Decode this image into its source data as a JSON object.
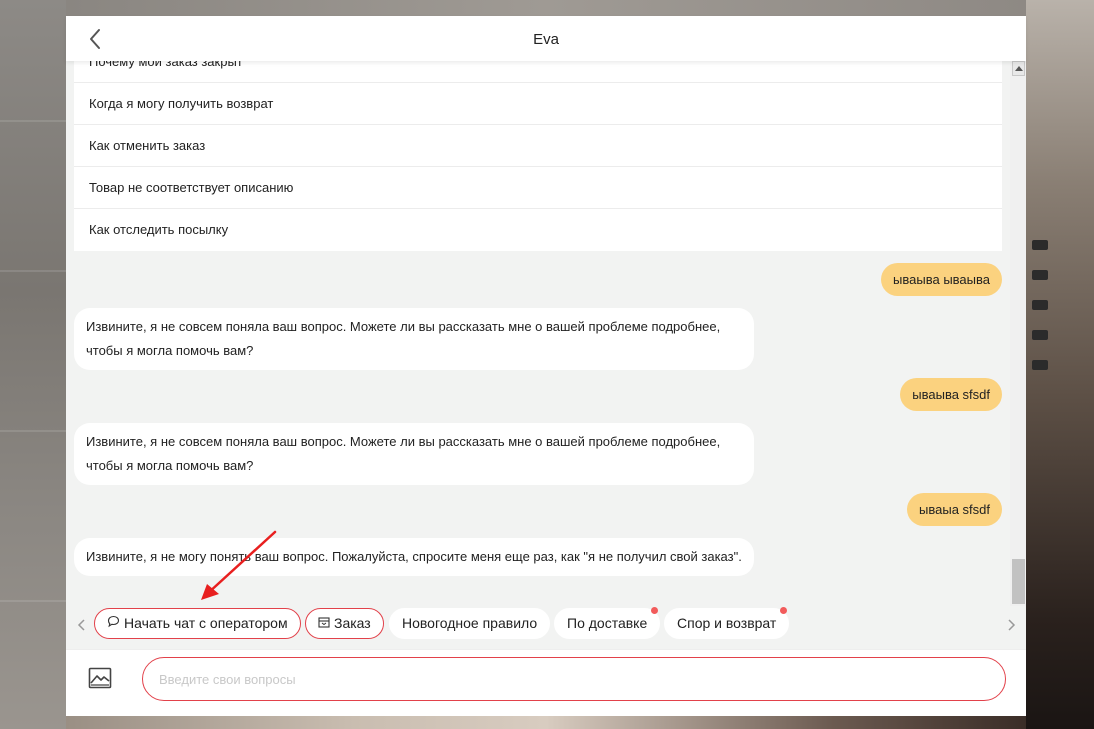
{
  "window": {
    "title": "Eva",
    "back_icon": "chevron-left-icon"
  },
  "faq": {
    "items": [
      "Почему мой заказ закрыт",
      "Когда я могу получить возврат",
      "Как отменить заказ",
      "Товар не соответствует описанию",
      "Как отследить посылку"
    ]
  },
  "messages": [
    {
      "from": "user",
      "text": "ываыва ываыва"
    },
    {
      "from": "bot",
      "text": "Извините, я не совсем поняла ваш вопрос. Можете ли вы рассказать мне о вашей проблеме подробнее, чтобы я могла помочь вам?"
    },
    {
      "from": "user",
      "text": "ываыва sfsdf"
    },
    {
      "from": "bot",
      "text": "Извините, я не совсем поняла ваш вопрос. Можете ли вы рассказать мне о вашей проблеме подробнее, чтобы я могла помочь вам?"
    },
    {
      "from": "user",
      "text": "ываыа sfsdf"
    },
    {
      "from": "bot",
      "text": "Извините, я не могу понять ваш вопрос. Пожалуйста, спросите меня еще раз, как \"я не получил свой заказ\"."
    }
  ],
  "quick_actions": [
    {
      "label": "Начать чат с оператором",
      "icon": "chat-bubble-icon"
    },
    {
      "label": "Заказ",
      "icon": "package-icon"
    },
    {
      "label": "Новогодное правило"
    },
    {
      "label": "По доставке"
    },
    {
      "label": "Спор и возврат"
    }
  ],
  "input": {
    "placeholder": "Введите свои вопросы",
    "value": "",
    "image_icon": "image-upload-icon"
  },
  "colors": {
    "accent": "#e2414a",
    "user_bubble": "#fbd27f",
    "chat_bg": "#f2f3f2",
    "notification_dot": "#f25b5b",
    "annotation_arrow": "#e81f1f"
  }
}
